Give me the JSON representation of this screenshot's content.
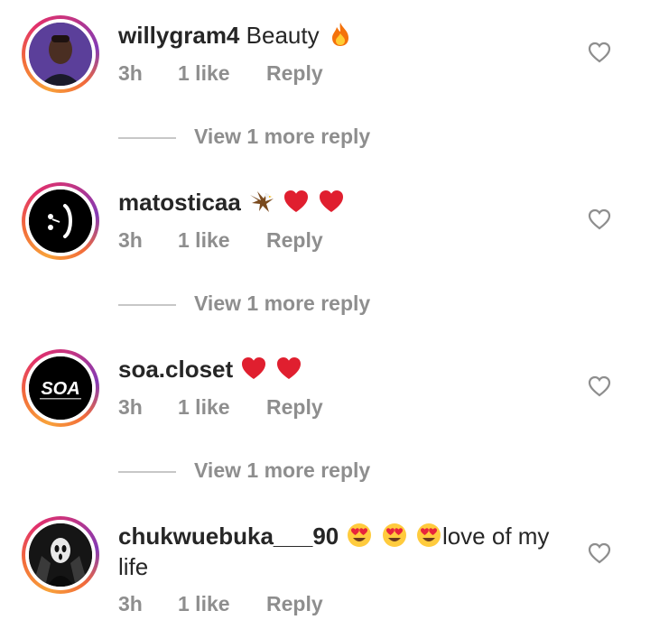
{
  "comments": [
    {
      "username": "willygram4",
      "text": "Beauty",
      "emojis": [
        "fire"
      ],
      "time": "3h",
      "likes": "1 like",
      "reply_label": "Reply",
      "view_replies": "View 1 more reply",
      "avatar_icon": "profile-photo"
    },
    {
      "username": "matosticaa",
      "text": "",
      "emojis": [
        "eagle",
        "red-heart",
        "red-heart"
      ],
      "time": "3h",
      "likes": "1 like",
      "reply_label": "Reply",
      "view_replies": "View 1 more reply",
      "avatar_icon": "logo-mark"
    },
    {
      "username": "soa.closet",
      "text": "",
      "emojis": [
        "red-heart",
        "red-heart"
      ],
      "time": "3h",
      "likes": "1 like",
      "reply_label": "Reply",
      "view_replies": "View 1 more reply",
      "avatar_icon": "soa-logo",
      "avatar_text": "SOA"
    },
    {
      "username": "chukwuebuka___90",
      "text_line1": "love of my",
      "text_line2": "life",
      "emojis": [
        "heart-eyes",
        "heart-eyes",
        "heart-eyes"
      ],
      "time": "3h",
      "likes": "1 like",
      "reply_label": "Reply",
      "avatar_icon": "profile-photo"
    }
  ],
  "colors": {
    "text": "#262626",
    "secondary": "#8e8e8e",
    "divider": "#c7c7c7",
    "heart": "#e0245e"
  }
}
